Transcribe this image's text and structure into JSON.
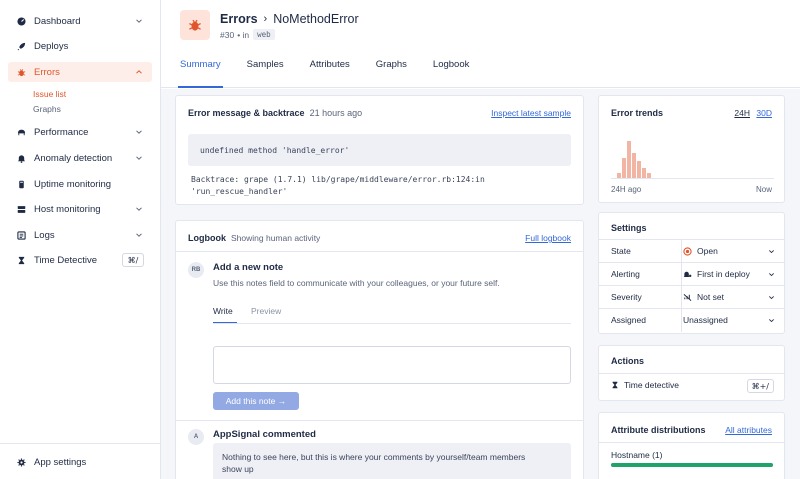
{
  "sidebar": {
    "items": [
      {
        "label": "Dashboard",
        "icon": "dashboard-icon",
        "chevron": true
      },
      {
        "label": "Deploys",
        "icon": "rocket-icon",
        "chevron": false
      },
      {
        "label": "Errors",
        "icon": "bug-icon",
        "chevron": true,
        "active": true
      },
      {
        "label": "Performance",
        "icon": "turtle-icon",
        "chevron": true
      },
      {
        "label": "Anomaly detection",
        "icon": "bell-icon",
        "chevron": true
      },
      {
        "label": "Uptime monitoring",
        "icon": "heartbeat-icon",
        "chevron": false
      },
      {
        "label": "Host monitoring",
        "icon": "server-icon",
        "chevron": true
      },
      {
        "label": "Logs",
        "icon": "logs-icon",
        "chevron": true
      },
      {
        "label": "Time Detective",
        "icon": "hourglass-icon",
        "shortcut": "⌘/"
      }
    ],
    "errors_sub": [
      "Issue list",
      "Graphs"
    ],
    "app_settings": "App settings"
  },
  "header": {
    "title": "Errors",
    "name": "NoMethodError",
    "number": "#30",
    "in_label": "• in",
    "namespace": "web",
    "tabs": [
      "Summary",
      "Samples",
      "Attributes",
      "Graphs",
      "Logbook"
    ],
    "active_tab": "Summary"
  },
  "error_card": {
    "title": "Error message & backtrace",
    "time": "21 hours ago",
    "link": "Inspect latest sample",
    "message": "undefined method 'handle_error'",
    "backtrace_line1": "Backtrace: grape (1.7.1) lib/grape/middleware/error.rb:124:in",
    "backtrace_line2": "'run_rescue_handler'"
  },
  "logbook": {
    "title": "Logbook",
    "subtitle": "Showing human activity",
    "link": "Full logbook",
    "avatar_initials": "RB",
    "note_title": "Add a new note",
    "note_desc": "Use this notes field to communicate with your colleagues, or your future self.",
    "tab_write": "Write",
    "tab_preview": "Preview",
    "button": "Add this note →",
    "comment_avatar": "A",
    "comment_title": "AppSignal commented",
    "comment_text_1": "Nothing to see here, but this is where your comments by yourself/team members",
    "comment_text_2": "show up"
  },
  "trends": {
    "title": "Error trends",
    "range_24h": "24H",
    "range_30d": "30D",
    "start_label": "24H ago",
    "end_label": "Now",
    "bars": [
      0.12,
      0.45,
      0.82,
      0.55,
      0.38,
      0.22,
      0.1
    ]
  },
  "settings": {
    "title": "Settings",
    "rows": [
      {
        "label": "State",
        "value": "Open",
        "icon": "open-circle-icon"
      },
      {
        "label": "Alerting",
        "value": "First in deploy",
        "icon": "bell-person-icon"
      },
      {
        "label": "Severity",
        "value": "Not set",
        "icon": "not-set-icon"
      },
      {
        "label": "Assigned",
        "value": "Unassigned",
        "icon": ""
      }
    ]
  },
  "actions": {
    "title": "Actions",
    "time_detective": "Time detective",
    "shortcut": "⌘+/"
  },
  "attributes": {
    "title": "Attribute distributions",
    "link": "All attributes",
    "hostname_label": "Hostname (1)",
    "hostname_share": 1.0
  },
  "colors": {
    "accent": "#3268d8",
    "error": "#e0562c",
    "success": "#1fa36b",
    "trend_bar": "#f2b4a3"
  }
}
